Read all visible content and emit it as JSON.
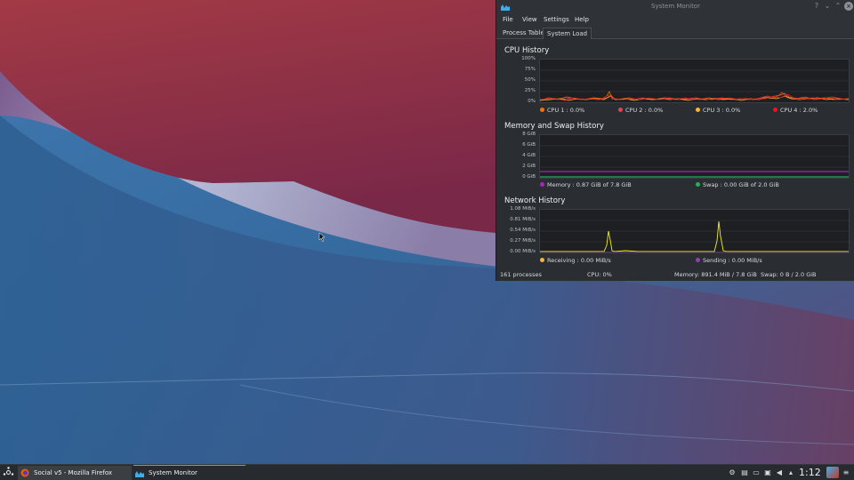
{
  "window": {
    "title": "System Monitor",
    "menu": [
      "File",
      "View",
      "Settings",
      "Help"
    ],
    "tabs": [
      "Process Table",
      "System Load"
    ],
    "active_tab": "System Load"
  },
  "cpu": {
    "title": "CPU History",
    "y_ticks": [
      "100%",
      "75%",
      "50%",
      "25%",
      "0%"
    ],
    "legend": [
      {
        "label": "CPU 1 : 0.0%",
        "color": "#f67400"
      },
      {
        "label": "CPU 2 : 0.0%",
        "color": "#da4453"
      },
      {
        "label": "CPU 3 : 0.0%",
        "color": "#f7b63a"
      },
      {
        "label": "CPU 4 : 2.0%",
        "color": "#ed1515"
      }
    ]
  },
  "memory": {
    "title": "Memory and Swap History",
    "y_ticks": [
      "8 GiB",
      "6 GiB",
      "4 GiB",
      "2 GiB",
      "0 GiB"
    ],
    "legend": [
      {
        "label": "Memory : 0.87 GiB of 7.8 GiB",
        "color": "#b11fc4"
      },
      {
        "label": "Swap : 0.00 GiB of 2.0 GiB",
        "color": "#27ae60"
      }
    ]
  },
  "network": {
    "title": "Network History",
    "y_ticks": [
      "1.08 MiB/s",
      "0.81 MiB/s",
      "0.54 MiB/s",
      "0.27 MiB/s",
      "0.00 MiB/s"
    ],
    "legend": [
      {
        "label": "Receiving : 0.00 MiB/s",
        "color": "#f7b63a"
      },
      {
        "label": "Sending : 0.00 MiB/s",
        "color": "#8e44ad"
      }
    ]
  },
  "status": {
    "processes": "161 processes",
    "cpu": "CPU: 0%",
    "memory": "Memory: 891.4 MiB / 7.8 GiB",
    "swap": "Swap: 0 B / 2.0 GiB"
  },
  "taskbar": {
    "tasks": [
      {
        "label": "Social v5 - Mozilla Firefox",
        "icon": "firefox-icon"
      },
      {
        "label": "System Monitor",
        "icon": "system-monitor-icon"
      }
    ],
    "clock": "1:12"
  }
}
